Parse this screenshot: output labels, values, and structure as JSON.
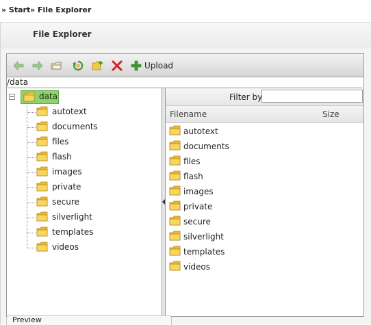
{
  "breadcrumb": {
    "items": [
      {
        "label": "» Start"
      },
      {
        "label": "» File Explorer"
      }
    ]
  },
  "panel": {
    "title": "File Explorer"
  },
  "toolbar": {
    "buttons": [
      {
        "icon": "back-arrow-icon",
        "label": ""
      },
      {
        "icon": "forward-arrow-icon",
        "label": ""
      },
      {
        "icon": "open-folder-icon",
        "label": ""
      },
      {
        "icon": "refresh-icon",
        "label": ""
      },
      {
        "icon": "new-folder-icon",
        "label": ""
      },
      {
        "icon": "delete-icon",
        "label": ""
      },
      {
        "icon": "upload-plus-icon",
        "label": "Upload"
      }
    ],
    "upload_label": "Upload"
  },
  "path": {
    "value": "/data"
  },
  "tree": {
    "root": {
      "label": "data",
      "expanded": true,
      "selected": true
    },
    "children": [
      {
        "label": "autotext"
      },
      {
        "label": "documents"
      },
      {
        "label": "files"
      },
      {
        "label": "flash"
      },
      {
        "label": "images"
      },
      {
        "label": "private"
      },
      {
        "label": "secure"
      },
      {
        "label": "silverlight"
      },
      {
        "label": "templates"
      },
      {
        "label": "videos"
      }
    ]
  },
  "filter": {
    "label": "Filter by",
    "value": ""
  },
  "grid": {
    "columns": {
      "filename": "Filename",
      "size": "Size"
    },
    "rows": [
      {
        "name": "autotext",
        "size": ""
      },
      {
        "name": "documents",
        "size": ""
      },
      {
        "name": "files",
        "size": ""
      },
      {
        "name": "flash",
        "size": ""
      },
      {
        "name": "images",
        "size": ""
      },
      {
        "name": "private",
        "size": ""
      },
      {
        "name": "secure",
        "size": ""
      },
      {
        "name": "silverlight",
        "size": ""
      },
      {
        "name": "templates",
        "size": ""
      },
      {
        "name": "videos",
        "size": ""
      }
    ]
  },
  "preview": {
    "label": "Preview"
  },
  "colors": {
    "selected_node_bg": "#8fd46a",
    "folder_yellow": "#f5c842",
    "toolbar_green": "#3c9a2c",
    "delete_red": "#d42020"
  }
}
